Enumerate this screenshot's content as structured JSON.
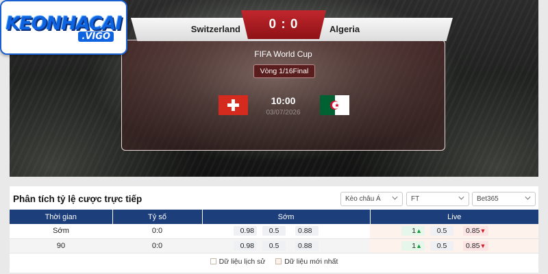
{
  "logo": {
    "main": "KEONHACAI",
    "sub": ".VIGO"
  },
  "match": {
    "home": "Switzerland",
    "away": "Algeria",
    "score": "0 : 0",
    "competition": "FIFA World Cup",
    "round": "Vòng 1/16Final",
    "time": "10:00",
    "date": "03/07/2026"
  },
  "colors": {
    "accent_red": "#c1272d",
    "header_blue": "#1c3f7c"
  },
  "odds": {
    "title": "Phân tích tỷ lệ cược trực tiếp",
    "filters": [
      "Kèo châu Á",
      "FT",
      "Bet365"
    ],
    "headers": [
      "Thời gian",
      "Tỷ số",
      "Sớm",
      "Live"
    ],
    "rows": [
      {
        "time": "Sớm",
        "score": "0:0",
        "early": [
          "0.98",
          "0.5",
          "0.88"
        ],
        "live": [
          "1",
          "0.5",
          "0.85"
        ]
      },
      {
        "time": "90",
        "score": "0:0",
        "early": [
          "0.98",
          "0.5",
          "0.88"
        ],
        "live": [
          "1",
          "0.5",
          "0.85"
        ]
      }
    ],
    "legend": [
      "Dữ liệu lịch sử",
      "Dữ liệu mới nhất"
    ]
  }
}
